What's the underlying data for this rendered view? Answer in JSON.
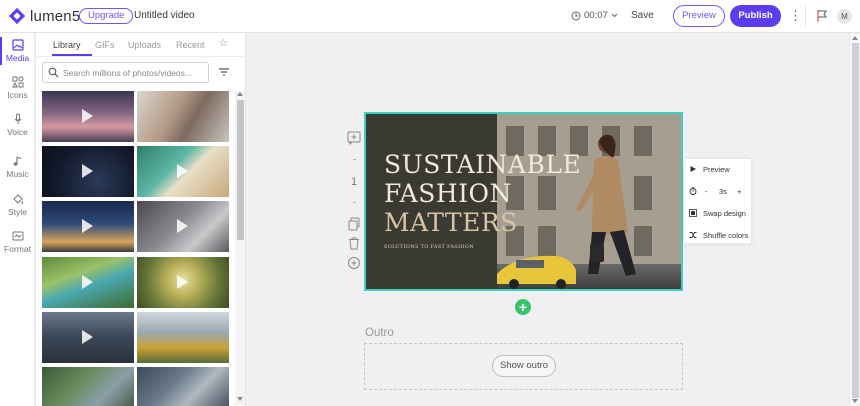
{
  "app": {
    "logo_text": "lumen5",
    "upgrade_label": "Upgrade",
    "video_title": "Untitled video",
    "duration": "00:07",
    "save_label": "Save",
    "preview_label": "Preview",
    "publish_label": "Publish",
    "avatar_initial": "M",
    "brand_color": "#5b3cf0"
  },
  "rail": {
    "items": [
      {
        "label": "Media",
        "icon": "image-icon"
      },
      {
        "label": "Icons",
        "icon": "shapes-icon"
      },
      {
        "label": "Voice",
        "icon": "microphone-icon"
      },
      {
        "label": "Music",
        "icon": "music-note-icon"
      },
      {
        "label": "Style",
        "icon": "paint-bucket-icon"
      },
      {
        "label": "Format",
        "icon": "aspect-ratio-icon"
      }
    ]
  },
  "library": {
    "tabs": [
      "Library",
      "GIFs",
      "Uploads",
      "Recent"
    ],
    "search_placeholder": "Search millions of photos/videos...",
    "thumbnails": [
      {
        "desc": "sunset-clouds",
        "video": true
      },
      {
        "desc": "woman-with-phone",
        "video": false
      },
      {
        "desc": "night-sky",
        "video": true
      },
      {
        "desc": "ocean-beach-aerial",
        "video": true
      },
      {
        "desc": "city-at-dusk",
        "video": true
      },
      {
        "desc": "man-at-desk",
        "video": true
      },
      {
        "desc": "river-valley",
        "video": true
      },
      {
        "desc": "dandelion-flower",
        "video": true
      },
      {
        "desc": "skyscrapers",
        "video": true
      },
      {
        "desc": "construction-workers",
        "video": false
      },
      {
        "desc": "green-rooftops",
        "video": false
      },
      {
        "desc": "city-grid",
        "video": false
      }
    ]
  },
  "scene": {
    "number": "1",
    "title_lines": [
      "SUSTAINABLE",
      "FASHION",
      "MATTERS"
    ],
    "subtitle": "SOLUTIONS TO FAST FASHION"
  },
  "context_menu": {
    "preview_label": "Preview",
    "duration_minus": "-",
    "duration_value": "3s",
    "duration_plus": "+",
    "swap_label": "Swap design",
    "shuffle_label": "Shuffle colors"
  },
  "outro": {
    "label": "Outro",
    "button_label": "Show outro"
  }
}
